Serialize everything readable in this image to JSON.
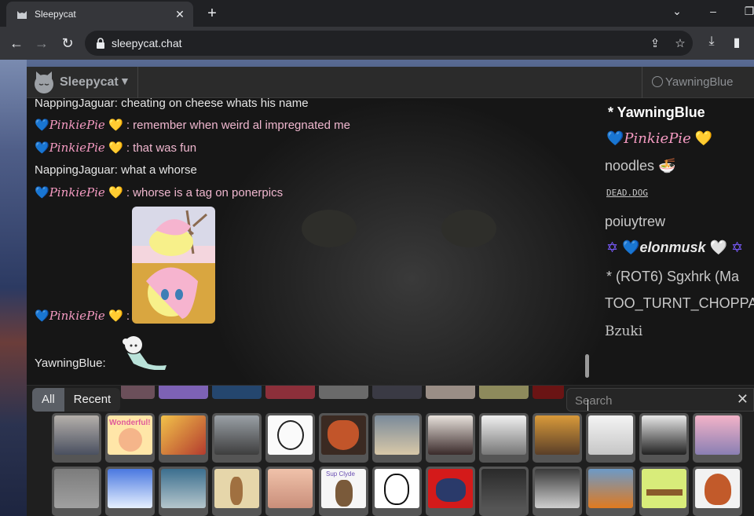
{
  "browser": {
    "tab_title": "Sleepycat",
    "url": "sleepycat.chat"
  },
  "app": {
    "title": "Sleepycat",
    "current_user": "YawningBlue"
  },
  "messages": [
    {
      "user": "NappingJaguar",
      "text": "cheating on cheese whats his name"
    },
    {
      "user": "PinkiePie",
      "text": "remember when weird al impregnated me"
    },
    {
      "user": "PinkiePie",
      "text": "that was fun"
    },
    {
      "user": "NappingJaguar",
      "text": "what a whorse"
    },
    {
      "user": "PinkiePie",
      "text": "whorse is a tag on ponerpics"
    },
    {
      "user": "PinkiePie",
      "text": ""
    },
    {
      "user": "YawningBlue",
      "text": ""
    }
  ],
  "hearts": {
    "blue": "💙",
    "yellow": "💛",
    "white": "🤍",
    "star_of_david": "✡",
    "noodles": "🍜"
  },
  "userlist": {
    "u1": "* YawningBlue",
    "u2": "PinkiePie",
    "u3": "noodles",
    "u4": "DEAD.DOG",
    "u5": "poiuytrew",
    "u6": "elonmusk",
    "u7": "* (ROT6) Sgxhrk (Ma",
    "u8": "TOO_TURNT_CHOPPA",
    "u9": "Bzuki"
  },
  "picker": {
    "tab_all": "All",
    "tab_recent": "Recent",
    "search_placeholder": "Search",
    "emote_texts": {
      "wonderful": "Wonderful!",
      "haruhi": "Sup Clyde"
    }
  },
  "colors": {
    "header_bg": "#2b2b2b",
    "pinkie_name": "#f49ac1",
    "pinkie_text": "#f0b7cf",
    "tab_active": "#5b5f66"
  }
}
